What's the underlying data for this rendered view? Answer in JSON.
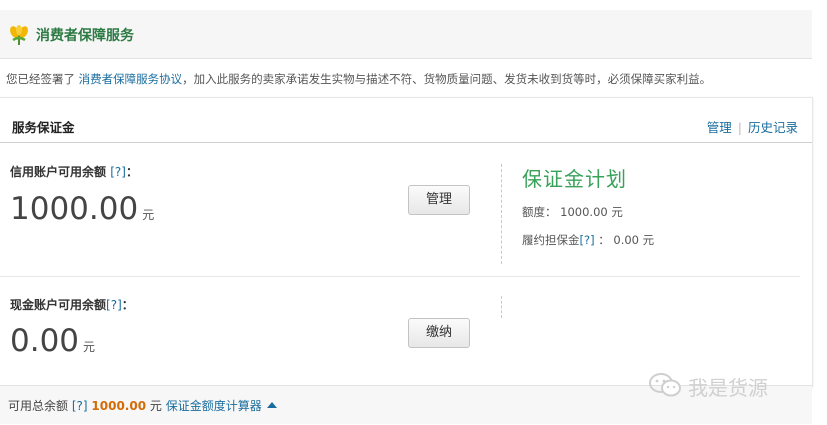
{
  "header": {
    "title": "消费者保障服务",
    "logo_icon": "sprout-icon"
  },
  "notice": {
    "prefix": "您已经签署了",
    "link": "消费者保障服务协议",
    "suffix": "，加入此服务的卖家承诺发生实物与描述不符、货物质量问题、发货未收到货等时，必须保障买家利益。"
  },
  "panel": {
    "title": "服务保证金",
    "links": {
      "manage": "管理",
      "history": "历史记录"
    }
  },
  "credit_account": {
    "label": "信用账户可用余额",
    "help": "[?]",
    "colon": "：",
    "amount": "1000.00",
    "unit": "元",
    "button": "管理"
  },
  "cash_account": {
    "label": "现金账户可用余额",
    "help": "[?]",
    "colon": "：",
    "amount": "0.00",
    "unit": "元",
    "button": "缴纳"
  },
  "plan": {
    "logo_text": "保证金计划",
    "quota_label": "额度：",
    "quota_value": "1000.00 元",
    "deposit_label": "履约担保金",
    "deposit_help": "[?]",
    "deposit_value": "： 0.00 元"
  },
  "footer": {
    "label": "可用总余额",
    "help": "[?]",
    "total": "1000.00",
    "unit": "元",
    "calculator_link": "保证金额度计算器"
  },
  "watermark": {
    "text": "我是货源",
    "icon": "wechat-icon"
  },
  "colors": {
    "brand_green": "#2d7a44",
    "link_blue": "#1a6d9e",
    "total_orange": "#d46b08"
  }
}
